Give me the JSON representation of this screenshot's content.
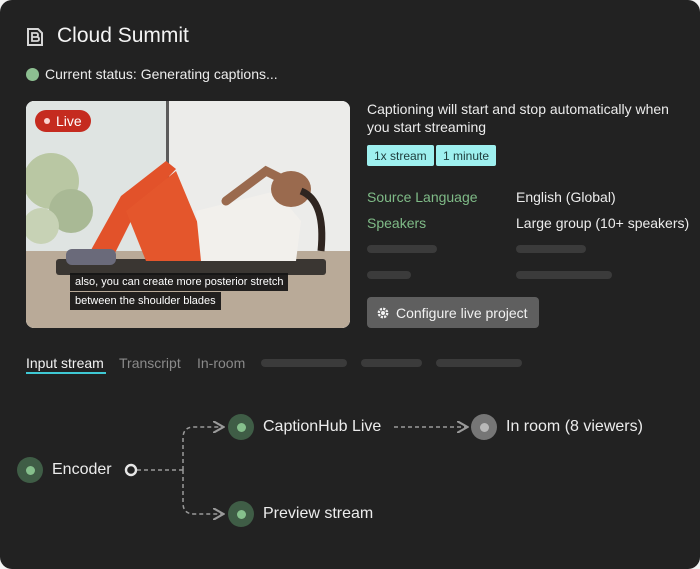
{
  "app": {
    "title": "Cloud Summit",
    "logo_icon": "b-logo-icon"
  },
  "status": {
    "text": "Current status: Generating captions...",
    "color": "#8dbf91"
  },
  "video": {
    "live_label": "Live",
    "caption_line1": "also, you can create more posterior stretch",
    "caption_line2": "between the shoulder blades"
  },
  "info": {
    "description": "Captioning will start and stop automatically when you start streaming",
    "chips": [
      "1x stream",
      "1 minute"
    ],
    "rows": [
      {
        "key": "Source Language",
        "value": "English (Global)"
      },
      {
        "key": "Speakers",
        "value": "Large group (10+ speakers)"
      }
    ],
    "configure_label": "Configure live project"
  },
  "tabs": [
    "Input stream",
    "Transcript",
    "In-room"
  ],
  "flow": {
    "encoder": "Encoder",
    "live": "CaptionHub Live",
    "preview": "Preview stream",
    "room": "In room (8 viewers)"
  },
  "colors": {
    "accent": "#3fc9d4",
    "live": "#c52b1f",
    "green": "#85c08c",
    "chip": "#9ef0ef"
  }
}
